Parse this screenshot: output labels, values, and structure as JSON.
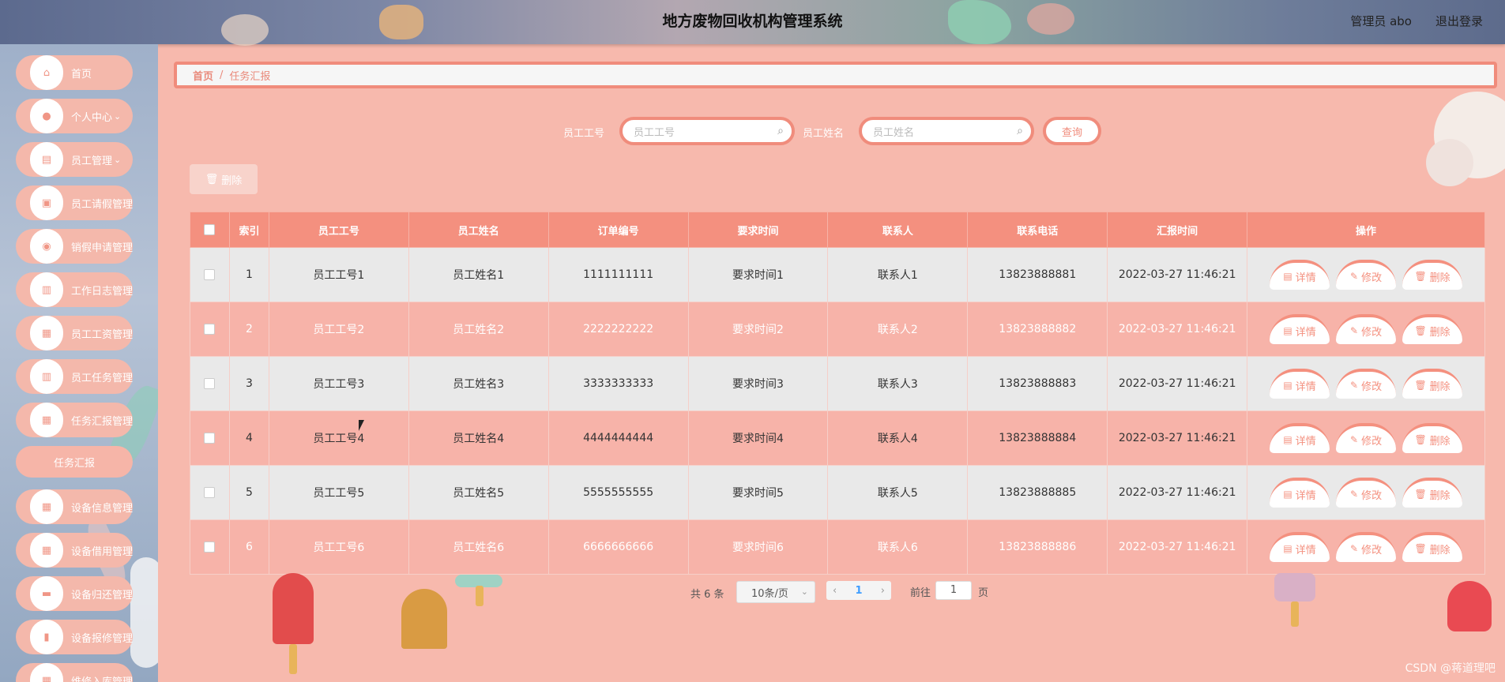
{
  "header": {
    "title": "地方废物回收机构管理系统",
    "user": "管理员 abo",
    "logout": "退出登录"
  },
  "sidebar": {
    "items": [
      {
        "label": "首页",
        "icon": "home-icon",
        "glyph": "⌂"
      },
      {
        "label": "个人中心",
        "icon": "user-icon",
        "glyph": "●",
        "expandable": true
      },
      {
        "label": "员工管理",
        "icon": "list-icon",
        "glyph": "▤",
        "expandable": true
      },
      {
        "label": "员工请假管理",
        "icon": "briefcase-icon",
        "glyph": "▣"
      },
      {
        "label": "销假申请管理",
        "icon": "location-icon",
        "glyph": "◉"
      },
      {
        "label": "工作日志管理",
        "icon": "clipboard-icon",
        "glyph": "▥"
      },
      {
        "label": "员工工资管理",
        "icon": "grid-icon",
        "glyph": "▦"
      },
      {
        "label": "员工任务管理",
        "icon": "clipboard-icon",
        "glyph": "▥"
      },
      {
        "label": "任务汇报管理",
        "icon": "grid-icon",
        "glyph": "▦"
      },
      {
        "label": "设备信息管理",
        "icon": "grid-icon",
        "glyph": "▦"
      },
      {
        "label": "设备借用管理",
        "icon": "grid-icon",
        "glyph": "▦"
      },
      {
        "label": "设备归还管理",
        "icon": "chat-icon",
        "glyph": "▬"
      },
      {
        "label": "设备报修管理",
        "icon": "chart-icon",
        "glyph": "▮"
      },
      {
        "label": "维修入库管理",
        "icon": "grid-icon",
        "glyph": "▦"
      }
    ],
    "submenu_label": "任务汇报"
  },
  "breadcrumb": {
    "home": "首页",
    "separator": "/",
    "current": "任务汇报"
  },
  "search": {
    "emp_no_label": "员工工号",
    "emp_no_placeholder": "员工工号",
    "emp_name_label": "员工姓名",
    "emp_name_placeholder": "员工姓名",
    "query_label": "查询"
  },
  "toolbar": {
    "delete_label": "删除"
  },
  "table": {
    "columns": [
      "索引",
      "员工工号",
      "员工姓名",
      "订单编号",
      "要求时间",
      "联系人",
      "联系电话",
      "汇报时间",
      "操作"
    ],
    "rows": [
      {
        "index": "1",
        "emp_no": "员工工号1",
        "emp_name": "员工姓名1",
        "order_no": "1111111111",
        "req_time": "要求时间1",
        "contact": "联系人1",
        "phone": "13823888881",
        "report_time": "2022-03-27 11:46:21"
      },
      {
        "index": "2",
        "emp_no": "员工工号2",
        "emp_name": "员工姓名2",
        "order_no": "2222222222",
        "req_time": "要求时间2",
        "contact": "联系人2",
        "phone": "13823888882",
        "report_time": "2022-03-27 11:46:21"
      },
      {
        "index": "3",
        "emp_no": "员工工号3",
        "emp_name": "员工姓名3",
        "order_no": "3333333333",
        "req_time": "要求时间3",
        "contact": "联系人3",
        "phone": "13823888883",
        "report_time": "2022-03-27 11:46:21"
      },
      {
        "index": "4",
        "emp_no": "员工工号4",
        "emp_name": "员工姓名4",
        "order_no": "4444444444",
        "req_time": "要求时间4",
        "contact": "联系人4",
        "phone": "13823888884",
        "report_time": "2022-03-27 11:46:21"
      },
      {
        "index": "5",
        "emp_no": "员工工号5",
        "emp_name": "员工姓名5",
        "order_no": "5555555555",
        "req_time": "要求时间5",
        "contact": "联系人5",
        "phone": "13823888885",
        "report_time": "2022-03-27 11:46:21"
      },
      {
        "index": "6",
        "emp_no": "员工工号6",
        "emp_name": "员工姓名6",
        "order_no": "6666666666",
        "req_time": "要求时间6",
        "contact": "联系人6",
        "phone": "13823888886",
        "report_time": "2022-03-27 11:46:21"
      }
    ],
    "actions": {
      "detail": "详情",
      "edit": "修改",
      "delete": "删除"
    }
  },
  "pagination": {
    "total": "共 6 条",
    "page_size": "10条/页",
    "current_page": "1",
    "goto_label": "前往",
    "goto_value": "1",
    "page_suffix": "页"
  },
  "watermark": "CSDN @蒋道理吧",
  "colors": {
    "accent": "#f4907f",
    "row_odd": "#e9e9e9",
    "row_even": "#f7b3a9"
  }
}
